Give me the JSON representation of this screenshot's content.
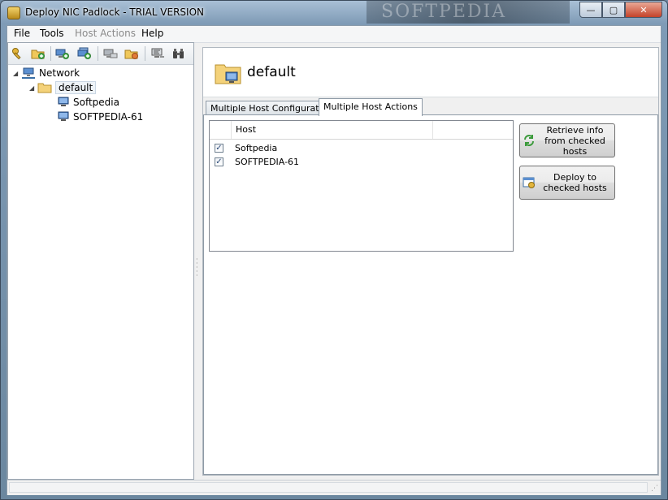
{
  "window": {
    "title": "Deploy NIC Padlock - TRIAL VERSION",
    "watermark": "SOFTPEDIA",
    "minimize_glyph": "—",
    "maximize_glyph": "▢",
    "close_glyph": "✕"
  },
  "menu": {
    "file": "File",
    "tools": "Tools",
    "host_actions": "Host Actions",
    "help": "Help"
  },
  "toolbar": {
    "icons": [
      "key-icon",
      "add-group-icon",
      "add-host-icon",
      "add-multiple-hosts-icon",
      "remove-host-icon",
      "edit-group-icon",
      "computer-properties-icon",
      "binoculars-icon"
    ]
  },
  "tree": {
    "root": "Network",
    "group": "default",
    "hosts": [
      "Softpedia",
      "SOFTPEDIA-61"
    ]
  },
  "main": {
    "header_title": "default",
    "tabs": [
      {
        "label": "Multiple Host Configuration",
        "active": false
      },
      {
        "label": "Multiple Host Actions",
        "active": true
      }
    ],
    "grid": {
      "column_header": "Host",
      "rows": [
        {
          "checked": true,
          "host": "Softpedia"
        },
        {
          "checked": true,
          "host": "SOFTPEDIA-61"
        }
      ],
      "check_glyph": "✓"
    },
    "buttons": {
      "retrieve": "Retrieve info from checked hosts",
      "deploy": "Deploy to checked hosts"
    }
  },
  "colors": {
    "accent": "#3a6ea5",
    "folder": "#e8b84a",
    "computer": "#4a7fc1"
  }
}
